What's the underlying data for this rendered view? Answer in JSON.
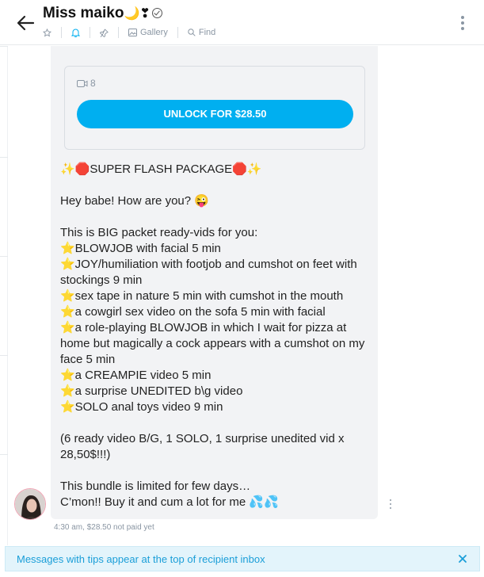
{
  "header": {
    "name": "Miss maiko",
    "name_emoji": "🌙❣",
    "toolbar": {
      "gallery_label": "Gallery",
      "find_label": "Find"
    }
  },
  "message": {
    "media_count": "8",
    "unlock_label": "UNLOCK FOR $28.50",
    "text": "✨🛑SUPER FLASH PACKAGE🛑✨\n\nHey babe! How are you? 😜\n\nThis is BIG packet ready-vids for you:\n⭐BLOWJOB with facial 5 min\n⭐JOY/humiliation with footjob and cumshot on feet with stockings 9 min\n⭐sex tape in nature 5 min with cumshot in the mouth\n⭐a cowgirl sex video on the sofa 5 min with facial\n⭐a role-playing BLOWJOB in which I wait for pizza at home but magically a cock appears with a cumshot on my face 5 min\n⭐a CREAMPIE video 5 min\n⭐a surprise UNEDITED b\\g video\n⭐SOLO anal toys video 9 min\n\n(6 ready video B/G, 1 SOLO, 1 surprise unedited vid x 28,50$!!!)\n\nThis bundle is limited for few days…\nC’mon!! Buy it and cum a lot for me 💦💦",
    "meta": "4:30 am,  $28.50 not paid yet"
  },
  "banner": {
    "text": "Messages with tips appear at the top of recipient inbox"
  },
  "colors": {
    "accent": "#00aff0",
    "banner_bg": "#e3f4fb",
    "bubble_bg": "#f2f3f5"
  }
}
